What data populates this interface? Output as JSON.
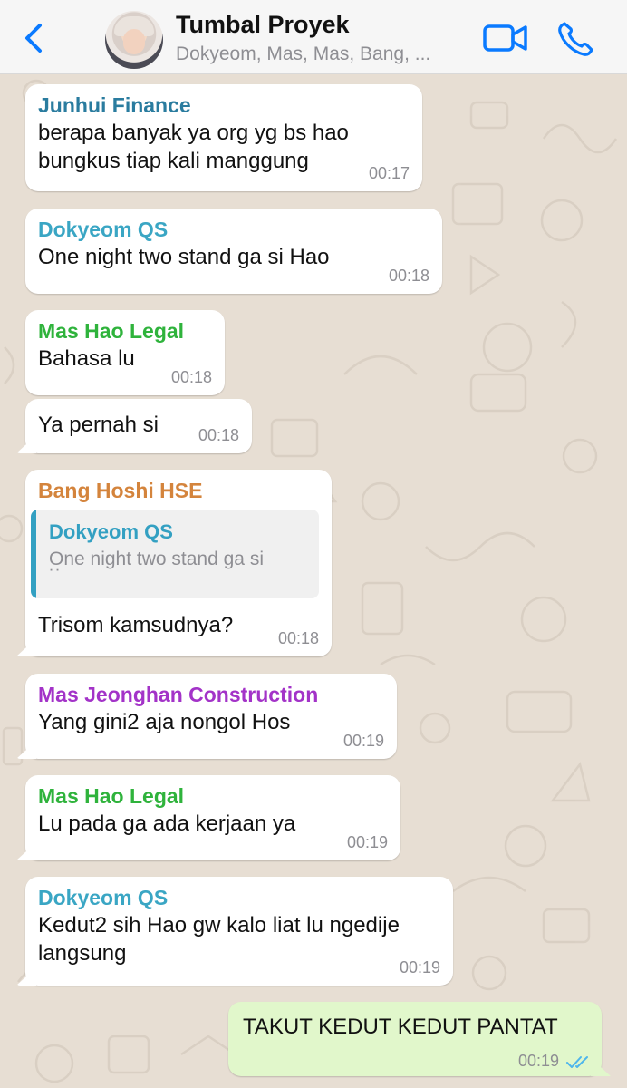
{
  "header": {
    "back_icon": "chevron-left-icon",
    "title": "Tumbal Proyek",
    "subtitle": "Dokyeom, Mas, Mas, Bang, ...",
    "video_icon": "video-camera-icon",
    "call_icon": "phone-icon"
  },
  "colors": {
    "accent": "#0a7aff",
    "chat_background": "#e7ded3",
    "incoming_bubble": "#ffffff",
    "outgoing_bubble": "#e1f7cb",
    "timestamp": "#8e8e93",
    "read_ticks": "#4fb6ec"
  },
  "messages": [
    {
      "sender": "Junhui Finance",
      "sender_color": "#2a7c9f",
      "lines": [
        "berapa banyak ya org yg bs hao",
        "bungkus tiap kali manggung"
      ],
      "time": "00:17"
    },
    {
      "sender": "Dokyeom QS",
      "sender_color": "#3aa6c4",
      "lines": [
        "One night two stand ga si Hao"
      ],
      "time": "00:18"
    },
    {
      "sender": "Mas Hao Legal",
      "sender_color": "#2fb33c",
      "lines": [
        "Bahasa lu"
      ],
      "time": "00:18"
    },
    {
      "sender": "",
      "lines": [
        "Ya pernah si"
      ],
      "time": "00:18"
    },
    {
      "sender": "Bang Hoshi HSE",
      "sender_color": "#d4843c",
      "quote": {
        "sender": "Dokyeom QS",
        "text": "One night two stand ga si",
        "overflow": "˙˙"
      },
      "lines": [
        "Trisom kamsudnya?"
      ],
      "time": "00:18"
    },
    {
      "sender": "Mas Jeonghan Construction",
      "sender_color": "#a333c8",
      "lines": [
        "Yang gini2 aja nongol Hos"
      ],
      "time": "00:19"
    },
    {
      "sender": "Mas Hao Legal",
      "sender_color": "#2fb33c",
      "lines": [
        "Lu pada ga ada kerjaan ya"
      ],
      "time": "00:19"
    },
    {
      "sender": "Dokyeom QS",
      "sender_color": "#3aa6c4",
      "lines": [
        "Kedut2 sih Hao gw kalo liat lu ngedije",
        "langsung"
      ],
      "time": "00:19"
    },
    {
      "sender": "",
      "outgoing": true,
      "lines": [
        "TAKUT KEDUT KEDUT PANTAT"
      ],
      "time": "00:19",
      "status_icon": "double-check-read-icon"
    }
  ]
}
